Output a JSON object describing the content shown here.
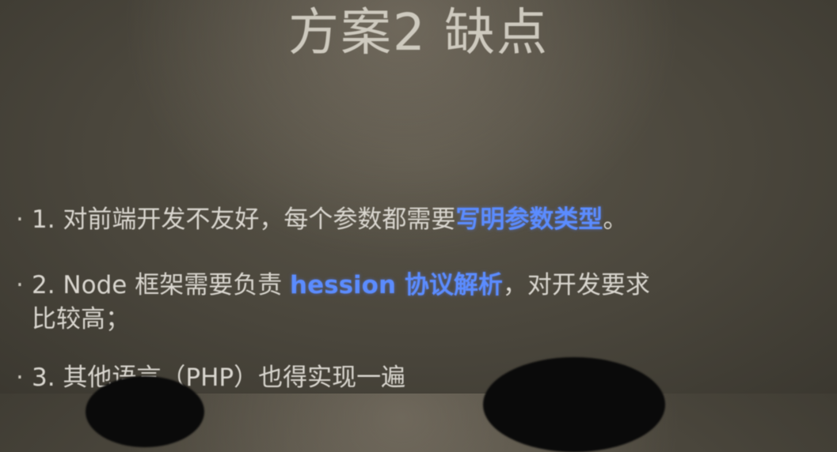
{
  "slide": {
    "title": "方案2 缺点",
    "bullets": {
      "b1": {
        "dot": "·",
        "text_before": "1. 对前端开发不友好，每个参数都需要",
        "highlight": "写明参数类型",
        "text_after": "。"
      },
      "b2": {
        "dot": "·",
        "text_before": "2. Node 框架需要负责 ",
        "highlight": "hession 协议解析",
        "text_after": "，对开发要求",
        "continuation": "比较高；"
      },
      "b3": {
        "dot": "·",
        "text": "3. 其他语言（PHP）也得实现一遍"
      }
    },
    "colors": {
      "highlight": "#5b8cff",
      "text": "#d9d6cf",
      "background": "#4a463c"
    }
  }
}
